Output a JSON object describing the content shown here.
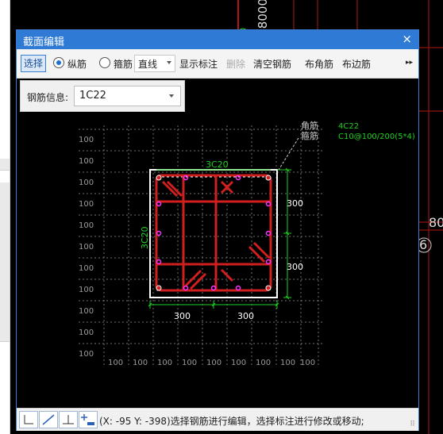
{
  "dialog": {
    "title": "截面编辑",
    "close_glyph": "×"
  },
  "toolbar": {
    "select_label": "选择",
    "longitudinal_label": "纵筋",
    "stirrup_label": "箍筋",
    "line_mode_value": "直线",
    "show_annotation_label": "显示标注",
    "delete_label": "删除",
    "clear_rebar_label": "清空钢筋",
    "corner_rebar_label": "布角筋",
    "edge_rebar_label": "布边筋",
    "more_glyph": "▸▸"
  },
  "rebar_info": {
    "label": "钢筋信息:",
    "value": "1C22"
  },
  "drawing": {
    "grid_labels": [
      "100",
      "100",
      "100",
      "100",
      "100",
      "100",
      "100",
      "100",
      "100",
      "100",
      "100"
    ],
    "top_label": "3C20",
    "left_label": "3C20",
    "right_dims": [
      "300",
      "300"
    ],
    "bottom_dims": [
      "300",
      "300"
    ],
    "legend_keys": [
      "角筋",
      "箍筋"
    ],
    "legend_values": [
      "4C22",
      "C10@100/200(5*4)"
    ]
  },
  "background": {
    "right_numbers": [
      "80",
      "6"
    ],
    "top_number": "8000"
  },
  "statusbar": {
    "icons": [
      "snap-icon",
      "line-icon",
      "axis-icon",
      "add-icon"
    ],
    "text": "(X: -95 Y: -398)选择钢筋进行编辑，选择标注进行修改或移动;"
  },
  "colors": {
    "title_bar": "#2f7ad4",
    "rebar": "#d11f1f",
    "green_text": "#1fd11f",
    "grid": "#6f6f6f"
  }
}
